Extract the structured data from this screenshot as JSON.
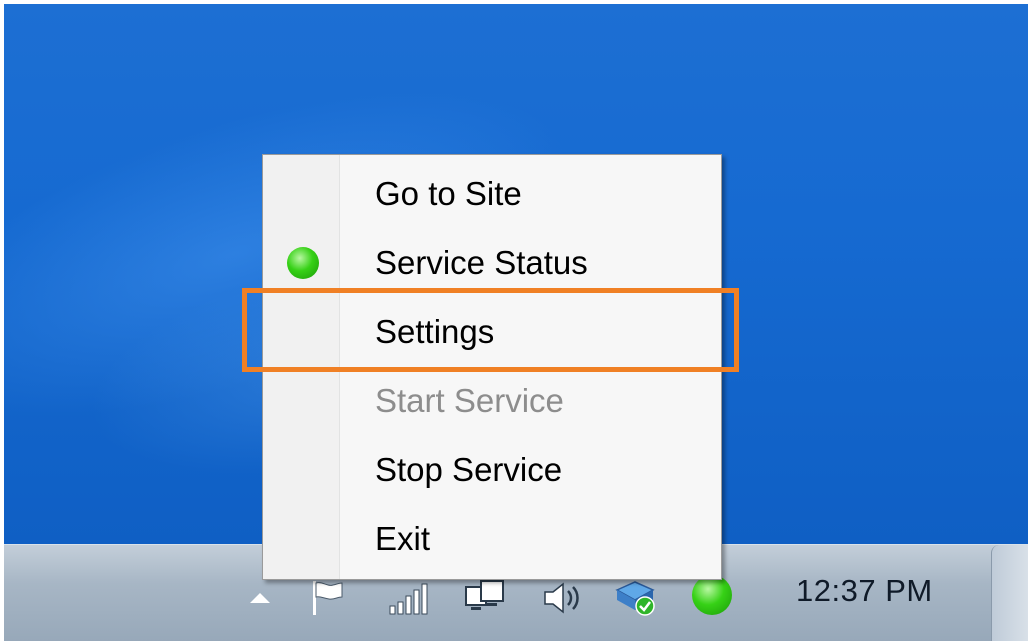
{
  "menu": {
    "items": [
      {
        "label": "Go to Site",
        "enabled": true,
        "icon": null
      },
      {
        "label": "Service Status",
        "enabled": true,
        "icon": "green-status-icon"
      },
      {
        "label": "Settings",
        "enabled": true,
        "icon": null,
        "highlighted": true
      },
      {
        "label": "Start Service",
        "enabled": false,
        "icon": null
      },
      {
        "label": "Stop Service",
        "enabled": true,
        "icon": null
      },
      {
        "label": "Exit",
        "enabled": true,
        "icon": null
      }
    ]
  },
  "taskbar": {
    "clock": "12:37 PM",
    "tray_icons": [
      "show-hidden-icons-chevron",
      "action-center-flag-icon",
      "network-signal-icon",
      "network-connection-icon",
      "volume-icon",
      "security-shield-icon",
      "green-status-icon"
    ]
  },
  "colors": {
    "desktop": "#166ad1",
    "highlight_box": "#f08025",
    "status_green": "#36d116",
    "disabled_text": "#8d8d8d"
  }
}
